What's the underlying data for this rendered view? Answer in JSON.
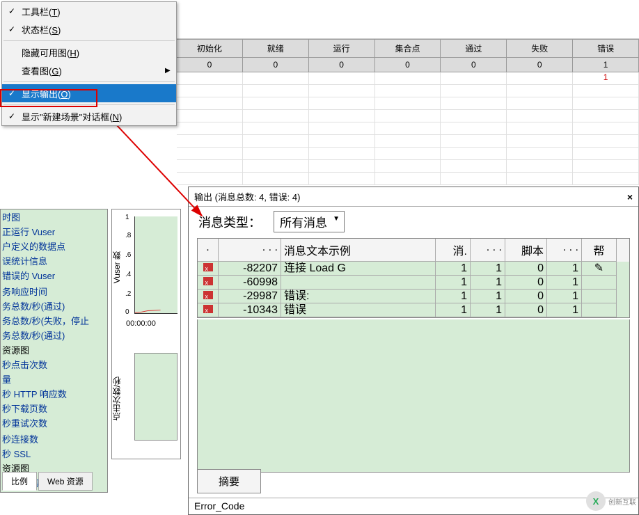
{
  "menu": {
    "toolbar": "工具栏(T)",
    "statusbar": "状态栏(S)",
    "hide_avail": "隐藏可用图(H)",
    "view_graph": "查看图(G)",
    "show_output": "显示输出(O)",
    "show_new_scene": "显示\"新建场景\"对话框(N)"
  },
  "grid": {
    "headers": [
      "初始化",
      "就绪",
      "运行",
      "集合点",
      "通过",
      "失败",
      "错误"
    ],
    "row0": [
      "0",
      "0",
      "0",
      "0",
      "0",
      "0",
      "1"
    ],
    "row1_err": "1"
  },
  "left_tree": {
    "items": [
      "时图",
      "正运行 Vuser",
      "户定义的数据点",
      "误统计信息",
      "错误的 Vuser",
      "",
      "务响应时间",
      "务总数/秒(通过)",
      "务总数/秒(失败，停止",
      "务总数/秒(通过)",
      "资源图",
      "秒点击次数",
      "量",
      "秒 HTTP 响应数",
      "秒下载页数",
      "秒重试次数",
      "",
      "秒连接数",
      "秒 SSL",
      "资源图",
      "dows 资源"
    ],
    "tabs": [
      "比例",
      "Web 资源"
    ]
  },
  "chart_data": [
    {
      "type": "line",
      "ylabel": "Vuser 数",
      "y_ticks": [
        "1",
        ".8",
        ".6",
        ".4",
        ".2",
        "0"
      ],
      "x_ticks": [
        "00:00:00",
        "0"
      ],
      "series": [
        {
          "name": "vuser",
          "color": "#d00",
          "values": [
            0,
            0.05,
            0.1,
            0.2
          ]
        }
      ]
    },
    {
      "type": "line",
      "ylabel": "点击次数/秒",
      "series": []
    }
  ],
  "output": {
    "title": "输出 (消息总数: 4, 错误: 4)",
    "close": "×",
    "msg_type_label": "消息类型：",
    "msg_type_value": "所有消息",
    "columns": {
      "c1": ".",
      "c2": ". . .",
      "c3": "消息文本示例",
      "c4": "消.",
      "c5": ". . .",
      "c6": "脚本",
      "c7": ". . .",
      "c8": "帮"
    },
    "rows": [
      {
        "code": "-82207",
        "text": "连接 Load G",
        "a": "1",
        "b": "1",
        "c": "0",
        "d": "1"
      },
      {
        "code": "-60998",
        "text": "",
        "a": "1",
        "b": "1",
        "c": "0",
        "d": "1"
      },
      {
        "code": "-29987",
        "text": "错误:",
        "a": "1",
        "b": "1",
        "c": "0",
        "d": "1"
      },
      {
        "code": "-10343",
        "text": "错误",
        "a": "1",
        "b": "1",
        "c": "0",
        "d": "1"
      }
    ],
    "summary": "摘要",
    "error_code": "Error_Code"
  },
  "watermark": "创新互联"
}
